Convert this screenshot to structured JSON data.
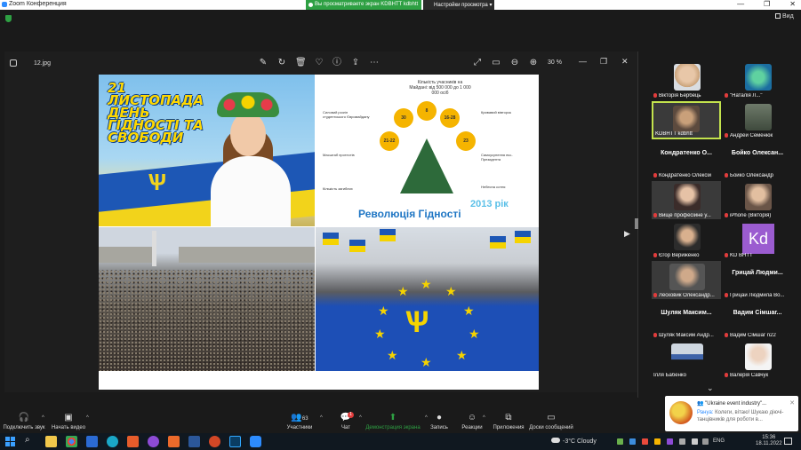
{
  "titlebar": {
    "app_title": "Zoom Конференция",
    "share_banner": "Вы просматриваете экран KDBHTT kdbhtt",
    "view_settings": "Настройки просмотра"
  },
  "top": {
    "view_label": "Вид"
  },
  "viewer": {
    "filename": "12.jpg",
    "zoom": "30 %"
  },
  "collage": {
    "q1_title": "21 ЛИСТОПАДА ДЕНЬ ГІДНОСТІ ТА СВОБОДИ",
    "q2_top_label": "Кількість учасників на Майдані: від 500 000 до 1 000 000 осіб",
    "q2_revolution": "Революція Гідності",
    "q2_year": "2013 рік",
    "q2_circles": [
      "30",
      "8",
      "16-28",
      "21-22",
      "23"
    ],
    "q2_facts": [
      "Силовий розгін студентського Євромайдану",
      "Кривавий вівторок",
      "Масштаб протестів",
      "Самоусунення екс-Президента",
      "Кількість загиблих",
      "Небесна сотня"
    ]
  },
  "participants": [
    {
      "name": "Вікторія Бербець",
      "type": "photo"
    },
    {
      "name": "\"Наталія Л...\"",
      "type": "photo"
    },
    {
      "name": "KDBHTT kdbhtt",
      "type": "video",
      "active": true
    },
    {
      "name": "Андрей Семенюк",
      "type": "photo"
    },
    {
      "name": "Кондратенко Олексій",
      "big": "Кондратенко О...",
      "type": "name"
    },
    {
      "name": "Бойко Олександр",
      "big": "Бойко Олексан...",
      "type": "name"
    },
    {
      "name": "Вище професійне у...",
      "type": "photo"
    },
    {
      "name": "iPhone (Вікторія)",
      "type": "photo"
    },
    {
      "name": "Єгор Вериженко",
      "type": "photo"
    },
    {
      "name": "KD ВНТТ",
      "type": "kd",
      "initials": "Kd"
    },
    {
      "name": "Лесковик Олександр...",
      "type": "video"
    },
    {
      "name": "Грицай Людмила Во...",
      "big": "Грицай Людми...",
      "type": "name"
    },
    {
      "name": "Шуляк Максим Андр...",
      "big": "Шуляк Максим...",
      "type": "name"
    },
    {
      "name": "Вадим Сімшаг n22",
      "big": "Вадим Сімшаг...",
      "type": "name"
    },
    {
      "name": "Ілля Бабенко",
      "type": "photo"
    },
    {
      "name": "Валерія Савчук",
      "type": "photo"
    }
  ],
  "toolbar": {
    "audio": "Подключить звук",
    "video": "Начать видео",
    "participants": "Участники",
    "participants_count": "63",
    "chat": "Чат",
    "chat_badge": "1",
    "share": "Демонстрация экрана",
    "record": "Запись",
    "reactions": "Реакции",
    "apps": "Приложения",
    "whiteboard": "Доски сообщений"
  },
  "notification": {
    "title": "\"Ukraine event industry\"...",
    "sender": "Ранya:",
    "body": "Колеги, вітаю! Шукаю діючі-танцівників для роботи в..."
  },
  "taskbar": {
    "weather": "-3°C  Cloudy",
    "lang": "ENG",
    "time": "15:36",
    "date": "18.11.2022"
  },
  "colors": {
    "share_green": "#2ea043",
    "active_tile": "#c3e34d",
    "flag_blue": "#1d57b5",
    "flag_yellow": "#f2d31b"
  }
}
